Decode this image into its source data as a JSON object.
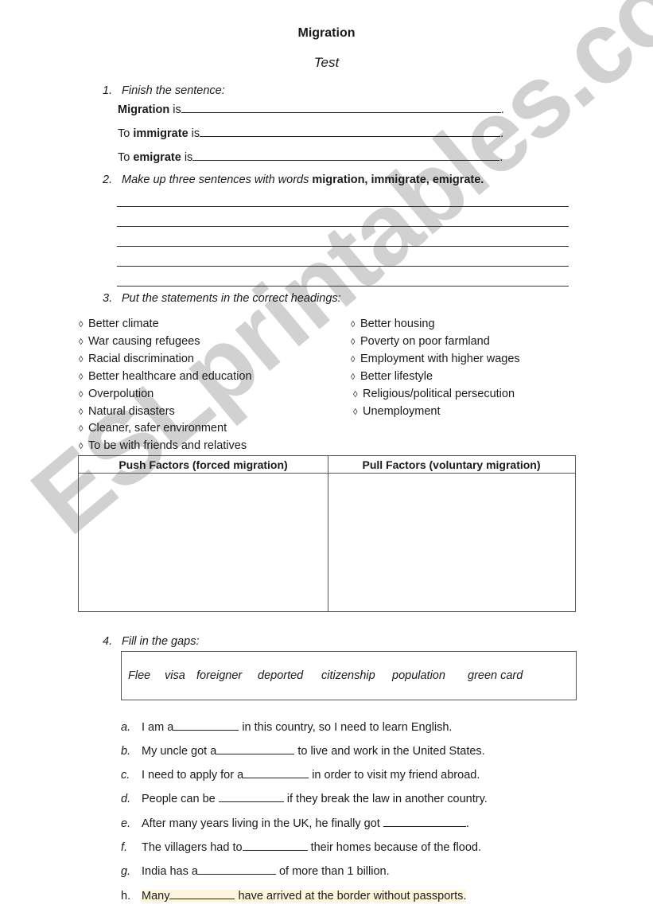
{
  "title": "Migration",
  "subtitle": "Test",
  "q1": {
    "number": "1.",
    "instruction": "Finish the sentence:",
    "lines": [
      {
        "pre": "",
        "bold": "Migration",
        "post": " is",
        "end": "."
      },
      {
        "pre": "To ",
        "bold": "immigrate",
        "post": " is",
        "end": "."
      },
      {
        "pre": "To ",
        "bold": "emigrate",
        "post": " is",
        "end": "."
      }
    ]
  },
  "q2": {
    "number": "2.",
    "instruction": "Make up three sentences with words ",
    "bold": "migration, immigrate, emigrate.",
    "line_count": 5
  },
  "q3": {
    "number": "3.",
    "instruction": "Put the statements in the correct headings:",
    "bullet": "◊",
    "left_items": [
      "Better climate",
      "War causing refugees",
      "Racial discrimination",
      "Better healthcare and education",
      "Overpolution",
      "Natural disasters",
      "Cleaner, safer environment",
      "To be with friends and relatives"
    ],
    "right_items": [
      "Better housing",
      "Poverty on poor farmland",
      "Employment with higher wages",
      "Better lifestyle",
      "Religious/political persecution",
      "Unemployment"
    ],
    "table": {
      "push_header": "Push Factors (forced migration)",
      "pull_header": "Pull Factors (voluntary migration)"
    }
  },
  "q4": {
    "number": "4.",
    "instruction": "Fill in the gaps:",
    "word_bank": [
      "Flee",
      "visa",
      "foreigner",
      "deported",
      "citizenship",
      "population",
      "green card"
    ],
    "sentences": [
      {
        "letter": "a.",
        "pre": "I am a",
        "post": " in this country, so I need to learn English."
      },
      {
        "letter": "b.",
        "pre": "My uncle got a",
        "post": " to live and work in the United States."
      },
      {
        "letter": "c.",
        "pre": "I need to apply for a",
        "post": " in order to visit my friend abroad."
      },
      {
        "letter": "d.",
        "pre": "People can be ",
        "post": " if they break the law in another country."
      },
      {
        "letter": "e.",
        "pre": "After many years living in the UK, he finally got ",
        "post": "."
      },
      {
        "letter": "f.",
        "pre": "The villagers had to",
        "post": " their homes because of the flood."
      },
      {
        "letter": "g.",
        "pre": "India has a",
        "post": " of more than 1 billion."
      },
      {
        "letter": "h.",
        "pre": "Many",
        "post": " have arrived at the border without passports."
      }
    ]
  },
  "watermark": "ESLprintables.com",
  "colors": {
    "highlight": "#fdf6dc",
    "watermark": "#c9c9c9"
  }
}
